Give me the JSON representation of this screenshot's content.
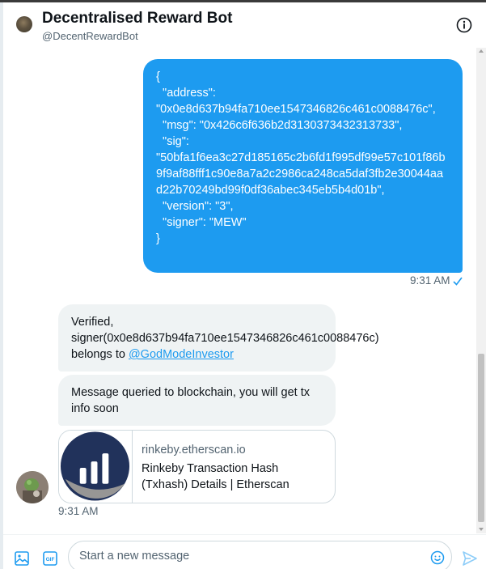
{
  "header": {
    "title": "Decentralised Reward Bot",
    "handle": "@DecentRewardBot",
    "info_icon": "info-icon"
  },
  "messages": {
    "outgoing": {
      "lines": [
        "{",
        "  \"address\":",
        "\"0x0e8d637b94fa710ee1547346826c461c0088476c\",",
        "  \"msg\": \"0x426c6f636b2d3130373432313733\",",
        "  \"sig\":",
        "\"50bfa1f6ea3c27d185165c2b6fd1f995df99e57c101f86b9f9af88fff1c90e8a7a2c2986ca248ca5daf3fb2e30044aad22b70249bd99f0df36abec345eb5b4d01b\",",
        "  \"version\": \"3\",",
        "  \"signer\": \"MEW\"",
        "}"
      ],
      "time": "9:31 AM",
      "status_icon": "check-icon"
    },
    "incoming": [
      {
        "text": "Verified, signer(0x0e8d637b94fa710ee1547346826c461c0088476c) belongs to ",
        "mention": "@GodModeInvestor"
      },
      {
        "text": "Message queried to blockchain, you will get tx info soon"
      }
    ],
    "card": {
      "domain": "rinkeby.etherscan.io",
      "title": "Rinkeby Transaction Hash (Txhash) Details | Etherscan",
      "thumb_icon": "etherscan-logo"
    },
    "incoming_time": "9:31 AM"
  },
  "composer": {
    "placeholder": "Start a new message",
    "media_icon": "image-icon",
    "gif_icon": "gif-icon",
    "emoji_icon": "emoji-icon",
    "send_icon": "send-icon"
  },
  "colors": {
    "accent": "#1d9bf0",
    "incoming_bg": "#eff3f4",
    "muted_text": "#536471"
  }
}
